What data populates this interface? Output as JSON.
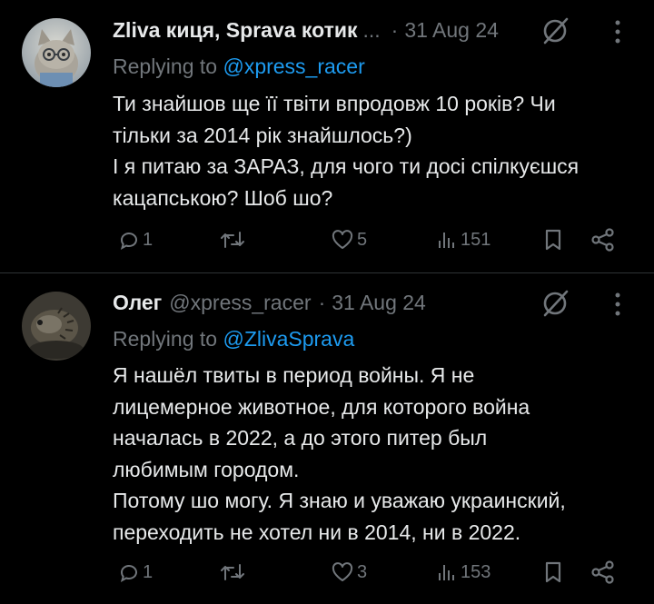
{
  "tweets": [
    {
      "author_name": "Zliva киця, Sprava котик",
      "truncation": "...",
      "date_separator": "·",
      "date": "31 Aug 24",
      "replying_prefix": "Replying to",
      "replying_to": "@xpress_racer",
      "text_lines": [
        "Ти знайшов ще її твіти впродовж 10 років? Чи",
        "тільки за 2014 рік знайшлось?)",
        " І я питаю за ЗАРАЗ, для чого ти досі спілкуєшся",
        "кацапською? Шоб шо?"
      ],
      "replies": "1",
      "reposts": "",
      "likes": "5",
      "views": "151",
      "avatar_icon": "cat-with-glasses-avatar"
    },
    {
      "author_name": "Олег",
      "handle": "@xpress_racer",
      "date_separator": "·",
      "date": "31 Aug 24",
      "replying_prefix": "Replying to",
      "replying_to": "@ZlivaSprava",
      "text_lines": [
        "Я нашёл твиты в период войны. Я не",
        "лицемерное животное, для которого война",
        "началась в 2022, а до этого питер был",
        "любимым городом.",
        "Потому шо могу. Я знаю и уважаю украинский,",
        "переходить не хотел ни в 2014, ни в 2022."
      ],
      "replies": "1",
      "reposts": "",
      "likes": "3",
      "views": "153",
      "avatar_icon": "hedgehog-avatar"
    }
  ],
  "colors": {
    "background": "#000000",
    "text": "#e7e9ea",
    "muted": "#71767b",
    "link": "#1d9bf0",
    "divider": "#2f3336"
  }
}
